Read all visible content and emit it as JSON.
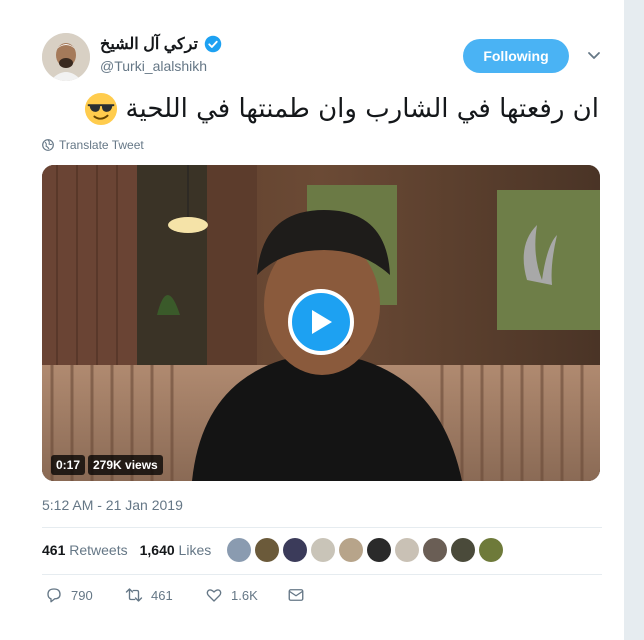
{
  "author": {
    "name": "تركي آل الشيخ",
    "handle": "@Turki_alalshikh",
    "verified": true
  },
  "follow_button": {
    "label": "Following"
  },
  "tweet": {
    "text": "ان رفعتها في الشارب وان طمنتها في اللحية",
    "emoji": "smiling-face-with-sunglasses"
  },
  "translate": {
    "label": "Translate Tweet"
  },
  "video": {
    "duration": "0:17",
    "views": "279K views"
  },
  "timestamp": "5:12 AM - 21 Jan 2019",
  "stats": {
    "retweets_count": "461",
    "retweets_label": "Retweets",
    "likes_count": "1,640",
    "likes_label": "Likes"
  },
  "liker_colors": [
    "#8a9bb0",
    "#6b5a3a",
    "#3b3b5a",
    "#c9c4b8",
    "#b7a48a",
    "#2a2a2a",
    "#c9c1b5",
    "#6a5e55",
    "#4a4a3a",
    "#6e7a3a"
  ],
  "actions": {
    "replies": "790",
    "retweets": "461",
    "likes": "1.6K"
  },
  "colors": {
    "accent": "#1da1f2",
    "follow_bg": "#4ab3f4",
    "muted_text": "#657786"
  }
}
